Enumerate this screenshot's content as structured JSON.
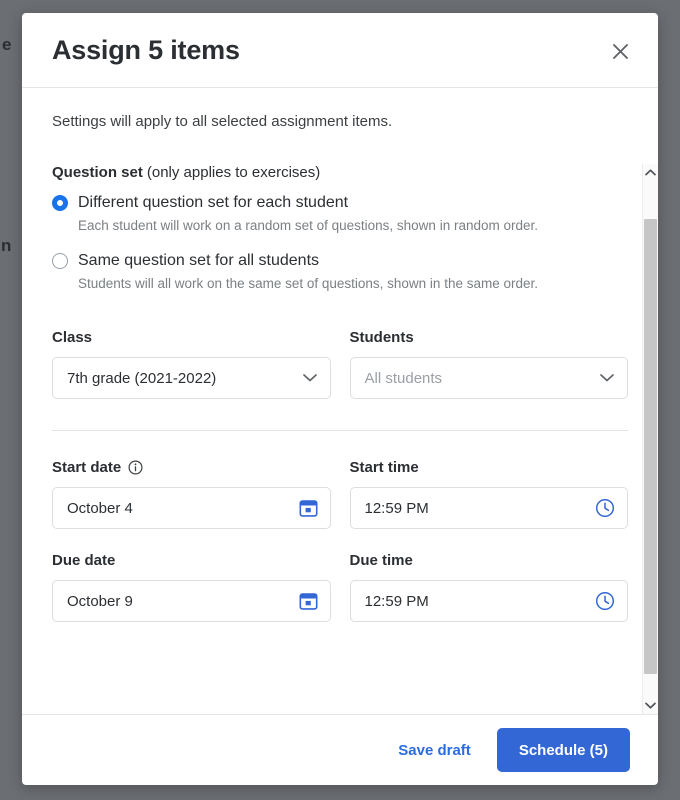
{
  "backdrop": {
    "partial_text_top": "e",
    "partial_text_mid": "n"
  },
  "modal": {
    "title": "Assign 5 items",
    "close_icon": "close-icon",
    "intro": "Settings will apply to all selected assignment items.",
    "question_set": {
      "heading": "Question set",
      "heading_note": "(only applies to exercises)",
      "options": [
        {
          "label": "Different question set for each student",
          "description": "Each student will work on a random set of questions, shown in random order.",
          "selected": true
        },
        {
          "label": "Same question set for all students",
          "description": "Students will all work on the same set of questions, shown in the same order.",
          "selected": false
        }
      ]
    },
    "audience": {
      "class": {
        "label": "Class",
        "value": "7th grade (2021-2022)",
        "icon": "chevron-down-icon"
      },
      "students": {
        "label": "Students",
        "placeholder": "All students",
        "icon": "chevron-down-icon"
      }
    },
    "schedule": {
      "start_date": {
        "label": "Start date",
        "info_icon": "info-icon",
        "value": "October 4",
        "icon": "calendar-icon"
      },
      "start_time": {
        "label": "Start time",
        "value": "12:59 PM",
        "icon": "clock-icon"
      },
      "due_date": {
        "label": "Due date",
        "value": "October 9",
        "icon": "calendar-icon"
      },
      "due_time": {
        "label": "Due time",
        "value": "12:59 PM",
        "icon": "clock-icon"
      }
    },
    "footer": {
      "save_draft_label": "Save draft",
      "schedule_label": "Schedule (5)"
    },
    "scrollbar": {
      "up_icon": "chevron-up-icon",
      "down_icon": "chevron-down-icon"
    }
  },
  "colors": {
    "accent_blue": "#1a73e8",
    "primary_button": "#3367d6",
    "link_blue": "#2b6cdf",
    "backdrop": "#6b6e73"
  }
}
